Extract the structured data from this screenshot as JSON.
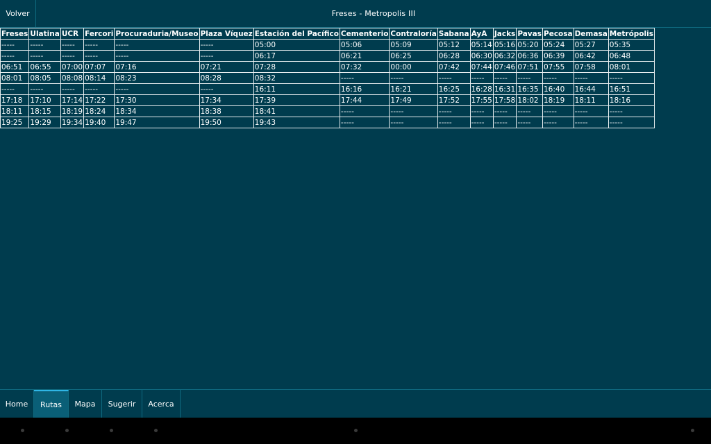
{
  "header": {
    "back_label": "Volver",
    "title": "Freses - Metropolis III"
  },
  "table": {
    "columns": [
      "Freses",
      "Ulatina",
      "UCR",
      "Fercori",
      "Procuraduria/Museo",
      "Plaza Víquez",
      "Estación del Pacífico",
      "Cementerio",
      "Contraloría",
      "Sabana",
      "AyA",
      "Jacks",
      "Pavas",
      "Pecosa",
      "Demasa",
      "Metrópolis"
    ],
    "rows": [
      [
        "-----",
        "-----",
        "-----",
        "-----",
        "-----",
        "-----",
        "05:00",
        "05:06",
        "05:09",
        "05:12",
        "05:14",
        "05:16",
        "05:20",
        "05:24",
        "05:27",
        "05:35"
      ],
      [
        "-----",
        "-----",
        "-----",
        "-----",
        "-----",
        "-----",
        "06:17",
        "06:21",
        "06:25",
        "06:28",
        "06:30",
        "06:32",
        "06:36",
        "06:39",
        "06:42",
        "06:48"
      ],
      [
        "06:51",
        "06:55",
        "07:00",
        "07:07",
        "07:16",
        "07:21",
        "07:28",
        "07:32",
        "00:00",
        "07:42",
        "07:44",
        "07:46",
        "07:51",
        "07:55",
        "07:58",
        "08:01"
      ],
      [
        "08:01",
        "08:05",
        "08:08",
        "08:14",
        "08:23",
        "08:28",
        "08:32",
        "-----",
        "-----",
        "-----",
        "-----",
        "-----",
        "-----",
        "-----",
        "-----",
        "-----"
      ],
      [
        "-----",
        "-----",
        "-----",
        "-----",
        "-----",
        "-----",
        "16:11",
        "16:16",
        "16:21",
        "16:25",
        "16:28",
        "16:31",
        "16:35",
        "16:40",
        "16:44",
        "16:51"
      ],
      [
        "17:18",
        "17:10",
        "17:14",
        "17:22",
        "17:30",
        "17:34",
        "17:39",
        "17:44",
        "17:49",
        "17:52",
        "17:55",
        "17:58",
        "18:02",
        "18:19",
        "18:11",
        "18:16"
      ],
      [
        "18:11",
        "18:15",
        "18:19",
        "18:24",
        "18:34",
        "18:38",
        "18:41",
        "-----",
        "-----",
        "-----",
        "-----",
        "-----",
        "-----",
        "-----",
        "-----",
        "-----"
      ],
      [
        "19:25",
        "19:29",
        "19:34",
        "19:40",
        "19:47",
        "19:50",
        "19:43",
        "-----",
        "-----",
        "-----",
        "-----",
        "-----",
        "-----",
        "-----",
        "-----",
        "-----"
      ]
    ]
  },
  "nav": {
    "tabs": [
      {
        "label": "Home",
        "active": false
      },
      {
        "label": "Rutas",
        "active": true
      },
      {
        "label": "Mapa",
        "active": false
      },
      {
        "label": "Sugerir",
        "active": false
      },
      {
        "label": "Acerca",
        "active": false
      }
    ]
  },
  "colors": {
    "background": "#003c4e",
    "active_tab": "#0a5f77",
    "active_indicator": "#2fb6e6",
    "grid_line": "#e8eef0"
  }
}
